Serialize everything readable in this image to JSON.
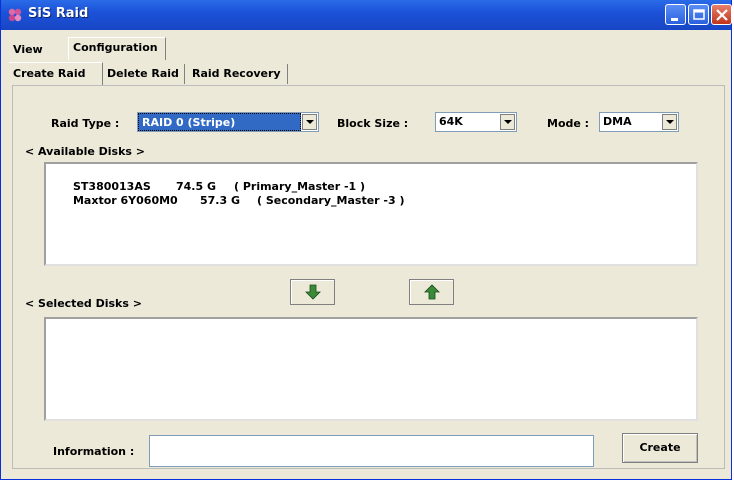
{
  "window": {
    "title": "SiS Raid"
  },
  "menu_tabs": [
    {
      "label": "View"
    },
    {
      "label": "Configuration"
    }
  ],
  "sub_tabs": [
    {
      "label": "Create Raid"
    },
    {
      "label": "Delete Raid"
    },
    {
      "label": "Raid Recovery"
    }
  ],
  "settings": {
    "raid_type_label": "Raid Type :",
    "raid_type_value": "RAID 0 (Stripe)",
    "block_size_label": "Block Size :",
    "block_size_value": "64K",
    "mode_label": "Mode :",
    "mode_value": "DMA"
  },
  "available_disks": {
    "header": "< Available Disks >",
    "rows": [
      {
        "name": "ST380013AS",
        "size": "74.5 G",
        "location": "( Primary_Master -1 )"
      },
      {
        "name": "Maxtor 6Y060M0",
        "size": "57.3 G",
        "location": "( Secondary_Master -3 )"
      }
    ]
  },
  "selected_disks": {
    "header": "< Selected Disks >"
  },
  "information": {
    "label": "Information :",
    "value": ""
  },
  "actions": {
    "create_label": "Create"
  },
  "colors": {
    "selected_highlight": "#316ac5",
    "titlebar": "#1c52d9"
  },
  "icons": {
    "add": "arrow-down-icon",
    "remove": "arrow-up-icon"
  }
}
